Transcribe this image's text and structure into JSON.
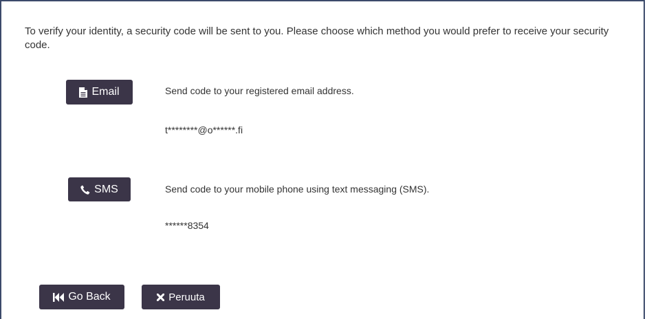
{
  "intro": {
    "text": "To verify your identity, a security code will be sent to you. Please choose which method you would prefer to receive your security code."
  },
  "methods": {
    "email": {
      "button_label": "Email",
      "icon": "document-icon",
      "description": "Send code to your registered email address.",
      "masked_value": "t********@o******.fi"
    },
    "sms": {
      "button_label": "SMS",
      "icon": "phone-icon",
      "description": "Send code to your mobile phone using text messaging (SMS).",
      "masked_value": "******8354"
    }
  },
  "actions": {
    "back_label": "Go Back",
    "back_icon": "fast-backward-icon",
    "cancel_label": "Peruuta",
    "cancel_icon": "close-icon"
  },
  "colors": {
    "button_bg": "#3b3548",
    "border": "#3c4a6b",
    "text": "#333333"
  }
}
